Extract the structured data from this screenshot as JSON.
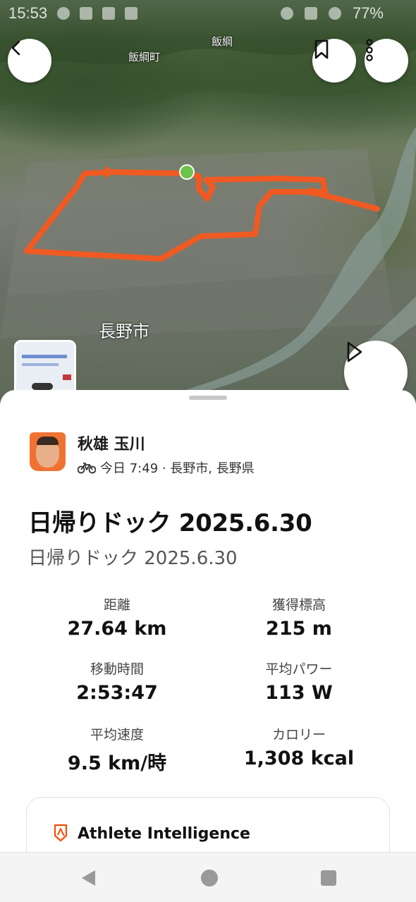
{
  "status_bar": {
    "time": "15:53",
    "battery": "77%"
  },
  "map": {
    "labels": {
      "top_left": "飯綱町",
      "top_center": "飯綱",
      "city": "長野市"
    }
  },
  "buttons": {
    "back_icon": "arrow-left-icon",
    "bookmark_icon": "bookmark-icon",
    "more_icon": "more-vertical-icon",
    "play_icon": "play-icon"
  },
  "activity": {
    "athlete_name": "秋雄 玉川",
    "meta": "今日 7:49 · 長野市, 長野県",
    "sport_icon": "bike-icon",
    "title": "日帰りドック 2025.6.30",
    "description": "日帰りドック 2025.6.30"
  },
  "stats": [
    {
      "label": "距離",
      "value": "27.64 km"
    },
    {
      "label": "獲得標高",
      "value": "215 m"
    },
    {
      "label": "移動時間",
      "value": "2:53:47"
    },
    {
      "label": "平均パワー",
      "value": "113 W"
    },
    {
      "label": "平均速度",
      "value": "9.5 km/時"
    },
    {
      "label": "カロリー",
      "value": "1,308 kcal"
    }
  ],
  "athlete_intelligence": {
    "title": "Athlete Intelligence",
    "icon": "strava-ai-icon"
  },
  "colors": {
    "route": "#f05a22",
    "start_marker": "#6cc24a",
    "accent": "#fc4c02"
  }
}
